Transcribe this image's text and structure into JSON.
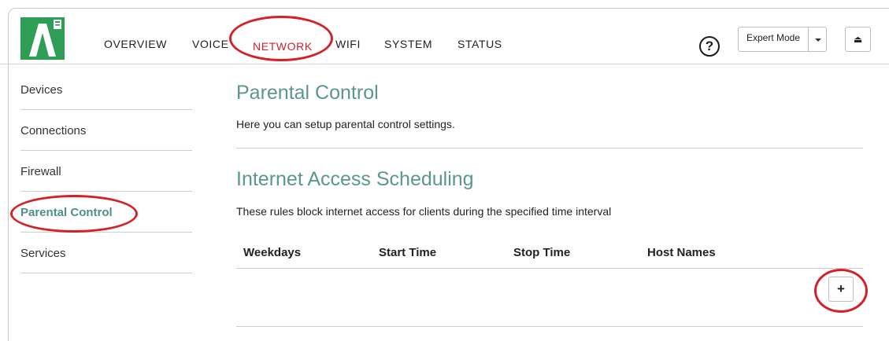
{
  "header": {
    "logo_icon": "a3-logo-icon",
    "nav": [
      {
        "label": "OVERVIEW",
        "active": false
      },
      {
        "label": "VOICE",
        "active": false
      },
      {
        "label": "NETWORK",
        "active": true
      },
      {
        "label": "WIFI",
        "active": false
      },
      {
        "label": "SYSTEM",
        "active": false
      },
      {
        "label": "STATUS",
        "active": false
      }
    ],
    "help_label": "?",
    "mode_label": "Expert Mode",
    "logout_label": "⏏"
  },
  "sidebar": {
    "items": [
      {
        "label": "Devices"
      },
      {
        "label": "Connections"
      },
      {
        "label": "Firewall"
      },
      {
        "label": "Parental Control"
      },
      {
        "label": "Services"
      }
    ]
  },
  "main": {
    "title": "Parental Control",
    "description": "Here you can setup parental control settings.",
    "section_title": "Internet Access Scheduling",
    "section_description": "These rules block internet access for clients during the specified time interval",
    "table_headers": [
      "Weekdays",
      "Start Time",
      "Stop Time",
      "Host Names"
    ],
    "add_label": "+"
  },
  "colors": {
    "accent": "#5b9690",
    "active_nav": "#d0202e",
    "logo_green": "#2e9e57",
    "annotation_red": "#d42026"
  }
}
